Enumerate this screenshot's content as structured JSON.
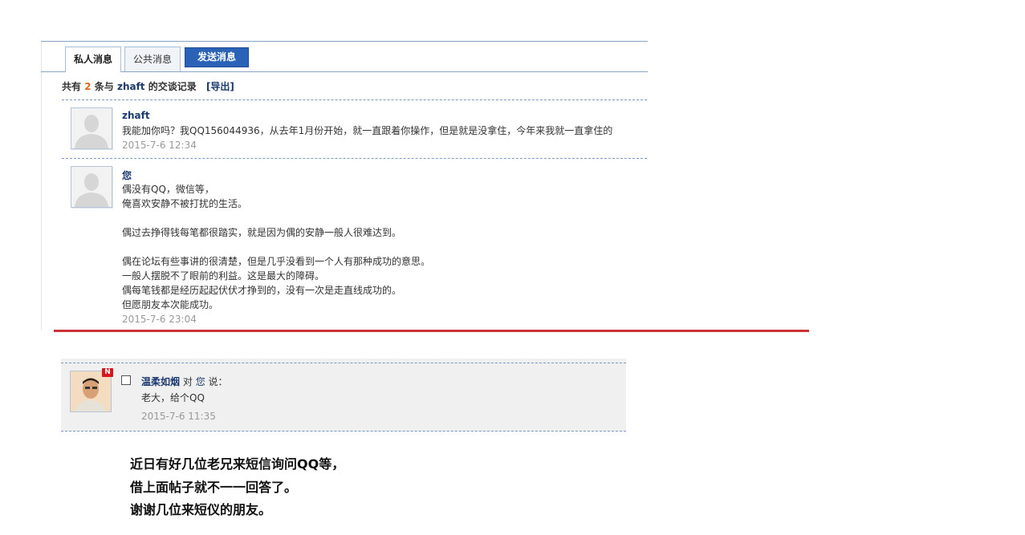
{
  "tabs": {
    "private_label": "私人消息",
    "public_label": "公共消息",
    "send_label": "发送消息"
  },
  "summary": {
    "prefix": "共有",
    "count": "2",
    "middle": "条与",
    "username": "zhaft",
    "suffix": "的交谈记录",
    "export_label": "[导出]"
  },
  "messages": [
    {
      "sender": "zhaft",
      "text": "我能加你吗？我QQ156044936，从去年1月份开始，就一直跟着你操作，但是就是没拿住，今年来我就一直拿住的",
      "time": "2015-7-6 12:34"
    },
    {
      "sender": "您",
      "text": "偶没有QQ，微信等，\n俺喜欢安静不被打扰的生活。\n\n偶过去挣得钱每笔都很踏实，就是因为偶的安静一般人很难达到。\n\n偶在论坛有些事讲的很清楚，但是几乎没看到一个人有那种成功的意思。\n一般人摆脱不了眼前的利益。这是最大的障碍。\n偶每笔钱都是经历起起伏伏才挣到的，没有一次是走直线成功的。\n但愿朋友本次能成功。",
      "time": "2015-7-6 23:04"
    }
  ],
  "comment": {
    "badge": "N",
    "author": "温柔如烟",
    "to_word": "对",
    "target": "您",
    "says": "说：",
    "text": "老大，给个QQ",
    "time": "2015-7-6 11:35"
  },
  "note": "近日有好几位老兄来短信询问QQ等，\n借上面帖子就不一一回答了。\n谢谢几位来短仪的朋友。",
  "colors": {
    "accent_blue": "#2a62b8",
    "link_navy": "#1b3a70",
    "count_orange": "#e06a1a",
    "divider_red": "#cc3338",
    "badge_red": "#d8141e"
  }
}
